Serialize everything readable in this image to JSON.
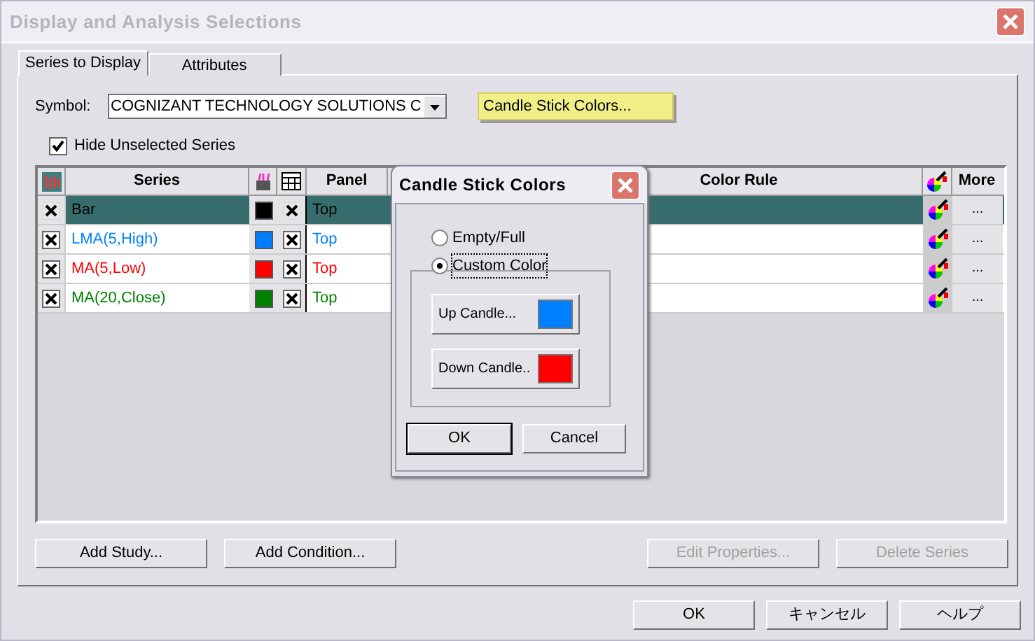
{
  "window": {
    "title": "Display and Analysis Selections"
  },
  "tabs": [
    {
      "label": "Series to Display",
      "selected": true
    },
    {
      "label": "Attributes",
      "selected": false
    }
  ],
  "symbol": {
    "label": "Symbol:",
    "value": "COGNIZANT TECHNOLOGY SOLUTIONS C"
  },
  "candle_button": "Candle Stick Colors...",
  "hide_unselected": {
    "label": "Hide Unselected Series",
    "checked": true
  },
  "table": {
    "columns": [
      "Series",
      "Panel",
      "Color Rule",
      "More"
    ],
    "rows": [
      {
        "series": "Bar",
        "visible": true,
        "color": "#000000",
        "panel_shown": true,
        "panel": "Top",
        "more": "...",
        "selected": true
      },
      {
        "series": "LMA(5,High)",
        "visible": true,
        "color": "#0080ff",
        "panel_shown": true,
        "panel": "Top",
        "more": "...",
        "selected": false
      },
      {
        "series": "MA(5,Low)",
        "visible": true,
        "color": "#ff0000",
        "panel_shown": true,
        "panel": "Top",
        "more": "...",
        "selected": false
      },
      {
        "series": "MA(20,Close)",
        "visible": true,
        "color": "#008000",
        "panel_shown": true,
        "panel": "Top",
        "more": "...",
        "selected": false
      }
    ]
  },
  "buttons": [
    {
      "label": "Add Study...",
      "disabled": false
    },
    {
      "label": "Add Condition...",
      "disabled": false
    },
    {
      "label": "Edit Properties...",
      "disabled": true
    },
    {
      "label": "Delete Series",
      "disabled": true
    }
  ],
  "dialog_buttons": [
    "OK",
    "キャンセル",
    "ヘルプ"
  ],
  "candle_dialog": {
    "title": "Candle Stick Colors",
    "options": [
      {
        "label": "Empty/Full",
        "selected": false
      },
      {
        "label": "Custom Color",
        "selected": true
      }
    ],
    "up": {
      "label": "Up Candle...",
      "color": "#0080ff"
    },
    "down": {
      "label": "Down Candle..",
      "color": "#ff0000"
    },
    "buttons": [
      "OK",
      "Cancel"
    ]
  }
}
